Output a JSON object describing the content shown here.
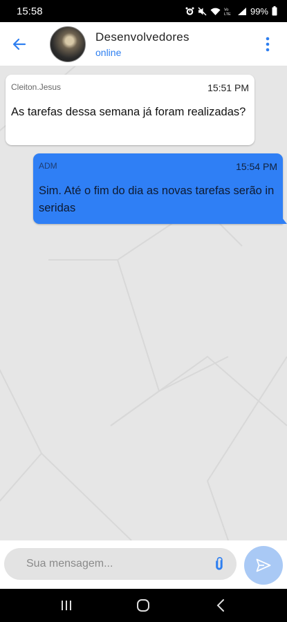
{
  "status_bar": {
    "time": "15:58",
    "network_label": "Vo\nLTE",
    "battery": "99%",
    "icons": [
      "alarm-icon",
      "mute-icon",
      "wifi-icon",
      "volte-icon",
      "signal-icon",
      "battery-icon"
    ]
  },
  "header": {
    "back_icon": "arrow-left-icon",
    "title": "Desenvolvedores",
    "status": "online",
    "menu_icon": "more-vertical-icon"
  },
  "messages": [
    {
      "direction": "incoming",
      "sender": "Cleiton.Jesus",
      "time": "15:51 PM",
      "text": "As tarefas dessa semana já foram realizadas?"
    },
    {
      "direction": "outgoing",
      "sender": "ADM",
      "time": "15:54 PM",
      "text": "Sim. Até o fim do dia as novas tarefas serão inseridas"
    }
  ],
  "composer": {
    "placeholder": "Sua mensagem...",
    "value": "",
    "attach_icon": "paperclip-icon",
    "send_icon": "send-icon"
  },
  "colors": {
    "accent": "#2f7ff5",
    "status_online": "#2e7ff0",
    "chat_background": "#e6e6e6",
    "send_button": "#a9c9f5"
  },
  "nav_bar": {
    "icons": [
      "recent-apps-icon",
      "home-icon",
      "back-nav-icon"
    ]
  }
}
